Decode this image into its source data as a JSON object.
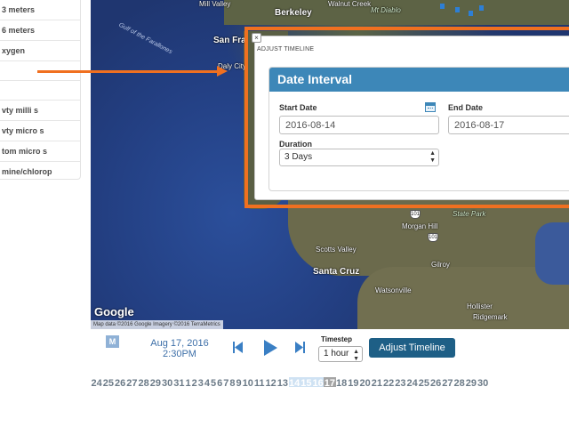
{
  "layers": [
    "3 meters",
    "6 meters",
    "xygen",
    "",
    "",
    "vty milli s",
    "vty micro s",
    "tom micro s",
    "mine/chlorop"
  ],
  "map": {
    "labels": {
      "mill_valley": "Mill Valley",
      "berkeley": "Berkeley",
      "walnut_creek": "Walnut Creek",
      "mt_diablo": "Mt Diablo",
      "san_francisco": "San Fra",
      "daly_city": "Daly City",
      "gulf": "Gulf of the Farallones",
      "morgan_hill": "Morgan Hill",
      "state_park": "State Park",
      "gilroy": "Gilroy",
      "scotts_valley": "Scotts Valley",
      "santa_cruz": "Santa Cruz",
      "watsonville": "Watsonville",
      "hollister": "Hollister",
      "ridgemark": "Ridgemark"
    },
    "highways": [
      "101",
      "101"
    ],
    "google_logo": "Google",
    "attribution": "Map data ©2016 Google Imagery ©2016 TerraMetrics"
  },
  "dialog": {
    "close_label": "×",
    "title": "ADJUST TIMELINE",
    "panel_title": "Date Interval",
    "start_label": "Start Date",
    "start_value": "2016-08-14",
    "end_label": "End Date",
    "end_value": "2016-08-17",
    "duration_label": "Duration",
    "duration_value": "3 Days",
    "select_arrow": "▲▼"
  },
  "controls": {
    "m_badge": "M",
    "date_line1": "Aug 17, 2016",
    "date_line2": "2:30PM",
    "timestep_label": "Timestep",
    "timestep_value": "1 hour",
    "adjust_button": "Adjust Timeline"
  },
  "timeline": {
    "ticks": [
      "24",
      "25",
      "26",
      "27",
      "28",
      "29",
      "30",
      "31",
      "1",
      "2",
      "3",
      "4",
      "5",
      "6",
      "7",
      "8",
      "9",
      "10",
      "11",
      "12",
      "13",
      "14",
      "15",
      "16",
      "17",
      "18",
      "19",
      "20",
      "21",
      "22",
      "23",
      "24",
      "25",
      "26",
      "27",
      "28",
      "29",
      "30"
    ],
    "selected": [
      "14",
      "15",
      "16"
    ],
    "current": "17"
  },
  "colors": {
    "accent": "#3d87b8",
    "highlight": "#f07020",
    "button": "#1e5f86"
  }
}
